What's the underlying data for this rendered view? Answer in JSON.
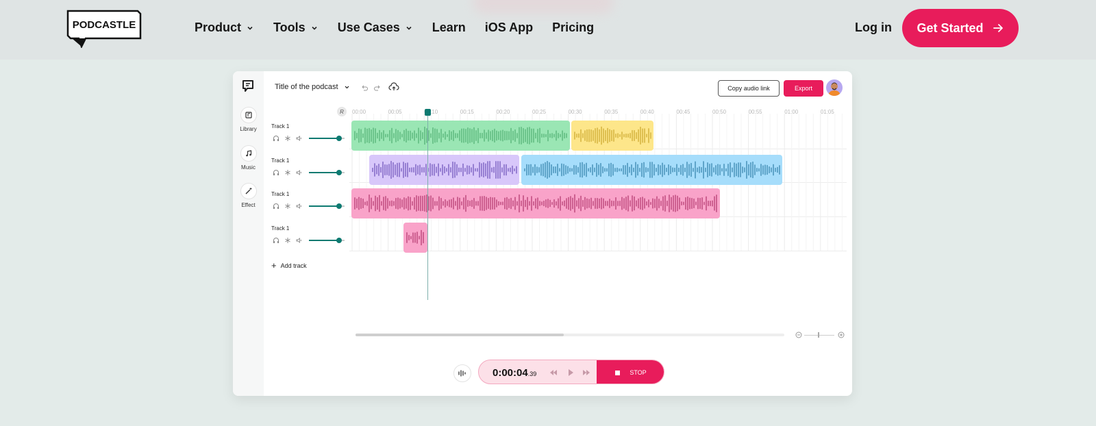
{
  "brand": {
    "name": "PODCASTLE"
  },
  "nav": {
    "items": [
      {
        "label": "Product",
        "dropdown": true
      },
      {
        "label": "Tools",
        "dropdown": true
      },
      {
        "label": "Use Cases",
        "dropdown": true
      },
      {
        "label": "Learn",
        "dropdown": false
      },
      {
        "label": "iOS App",
        "dropdown": false
      },
      {
        "label": "Pricing",
        "dropdown": false
      }
    ],
    "login_label": "Log in",
    "cta_label": "Get Started"
  },
  "editor": {
    "title": "Title of the podcast",
    "copy_link_label": "Copy audio link",
    "export_label": "Export",
    "sidebar": [
      {
        "label": "Library",
        "icon": "library-icon"
      },
      {
        "label": "Music",
        "icon": "music-icon"
      },
      {
        "label": "Effect",
        "icon": "magic-wand-icon"
      }
    ],
    "ruler_ticks": [
      "00:00",
      "00:05",
      "00:10",
      "00:15",
      "00:20",
      "00:25",
      "00:30",
      "00:35",
      "00:40",
      "00:45",
      "00:50",
      "00:55",
      "01:00",
      "01:05"
    ],
    "tracks": [
      {
        "label": "Track 1",
        "volume": 0.85
      },
      {
        "label": "Track 1",
        "volume": 0.85
      },
      {
        "label": "Track 1",
        "volume": 0.85
      },
      {
        "label": "Track 1",
        "volume": 0.85
      }
    ],
    "add_track_label": "Add track",
    "player": {
      "time_main": "0:00:04",
      "time_ms": ".39",
      "stop_label": "STOP"
    },
    "colors": {
      "accent": "#e81c5b",
      "teal": "#0d7a71",
      "clip_green": "#9ae6b4",
      "clip_yellow": "#fde68a",
      "clip_purple": "#d8c7fa",
      "clip_blue": "#a6ddfb",
      "clip_pink": "#f9a3c9"
    }
  }
}
